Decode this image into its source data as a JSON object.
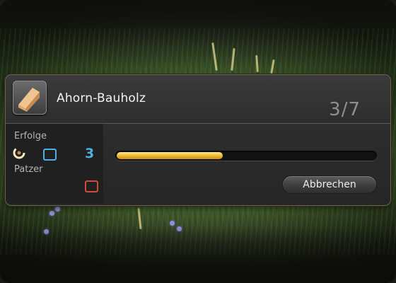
{
  "item": {
    "name": "Ahorn-Bauholz",
    "icon": "lumber-plank-icon"
  },
  "steps": {
    "text": "3/7"
  },
  "successes": {
    "label": "Erfolge",
    "count": "3",
    "color": "#4bb0e6"
  },
  "failures": {
    "label": "Patzer",
    "color": "#d24a3a"
  },
  "progress": {
    "fraction": 0.41,
    "color": "#f0c23a"
  },
  "buttons": {
    "cancel_label": "Abbrechen"
  }
}
